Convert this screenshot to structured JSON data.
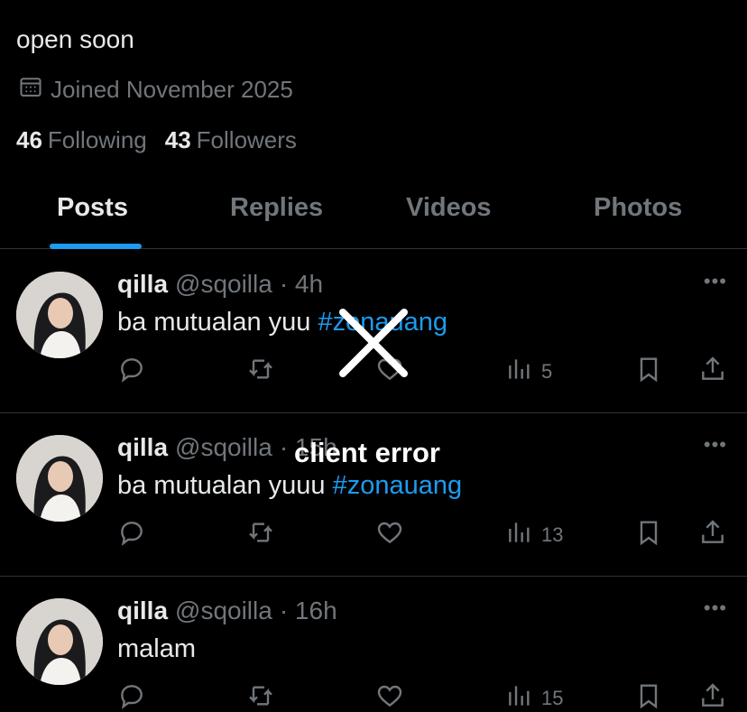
{
  "profile": {
    "bio": "open soon",
    "joined": "Joined November 2025",
    "following_count": "46",
    "following_label": "Following",
    "followers_count": "43",
    "followers_label": "Followers"
  },
  "tabs": [
    {
      "label": "Posts",
      "active": true
    },
    {
      "label": "Replies",
      "active": false
    },
    {
      "label": "Videos",
      "active": false
    },
    {
      "label": "Photos",
      "active": false
    }
  ],
  "posts": [
    {
      "name": "qilla",
      "handle": "@sqoilla",
      "time": "· 4h",
      "text": "ba mutualan yuu",
      "hashtag": "#zonauang",
      "views": "5"
    },
    {
      "name": "qilla",
      "handle": "@sqoilla",
      "time": "· 15h",
      "text": "ba mutualan yuuu",
      "hashtag": "#zonauang",
      "views": "13"
    },
    {
      "name": "qilla",
      "handle": "@sqoilla",
      "time": "· 16h",
      "text": "malam",
      "hashtag": "",
      "views": "15"
    }
  ],
  "error": {
    "label": "client error"
  },
  "colors": {
    "background": "#000000",
    "accent": "#1d9bf0",
    "muted": "#71767b",
    "text": "#e7e9ea",
    "divider": "#2f3336"
  },
  "icons": [
    "calendar-icon",
    "more-icon",
    "reply-icon",
    "repost-icon",
    "like-icon",
    "views-icon",
    "bookmark-icon",
    "share-icon",
    "close-icon"
  ]
}
